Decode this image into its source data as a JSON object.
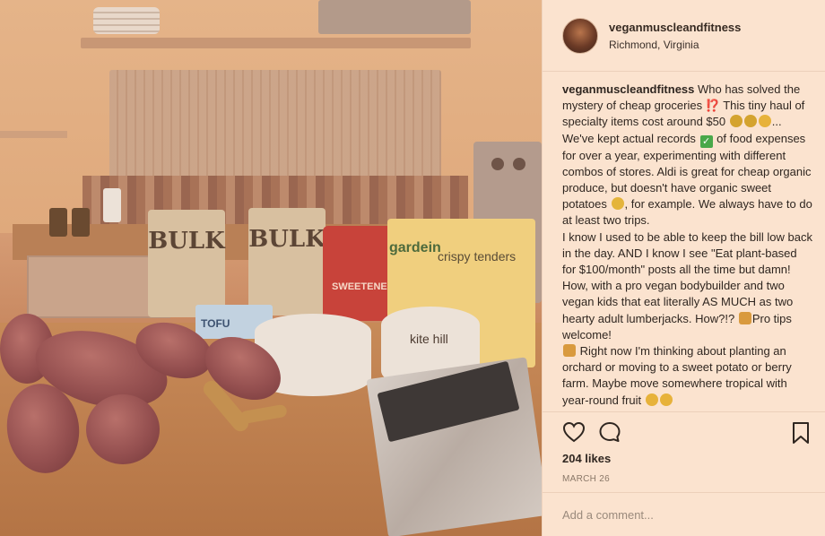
{
  "post": {
    "username": "veganmuscleandfitness",
    "location": "Richmond, Virginia",
    "caption_user": "veganmuscleandfitness",
    "caption_p1_a": " Who has solved the mystery of cheap groceries ⁉️ This tiny haul of specialty items cost around $50 ",
    "caption_p1_b": "... We've kept actual records ",
    "caption_p1_c": " of food expenses for over a year, experimenting with different combos of stores. Aldi is great for cheap organic produce, but doesn't have organic sweet potatoes ",
    "caption_p1_d": ", for example. We always have to do at least two trips.",
    "caption_p2_a": "I know I used to be able to keep the bill low back in the day. AND I know I see \"Eat plant-based for $100/month\" posts all the time but damn! How, with a pro vegan bodybuilder and two vegan kids that eat literally AS MUCH as two hearty adult lumberjacks. How?!? ",
    "caption_p2_b": "Pro tips welcome!",
    "caption_p2_c": " Right now I'm thinking about planting an orchard or moving to a sweet potato or berry farm. Maybe move somewhere tropical with year-round fruit ",
    "likes": "204 likes",
    "date": "MARCH 26",
    "comment_placeholder": "Add a comment..."
  },
  "photo_labels": {
    "bulk1": "BULK",
    "bulk2": "BULK",
    "sweetener": "SWEETENER",
    "tenders_brand": "gardein",
    "tenders_name": "crispy tenders",
    "tofu": "TOFU",
    "kitehill": "kite hill"
  },
  "icons": {
    "heart": "heart-icon",
    "comment": "comment-icon",
    "bookmark": "bookmark-icon"
  },
  "colors": {
    "panel_bg": "#fbe3cf",
    "text": "#2f2620"
  }
}
